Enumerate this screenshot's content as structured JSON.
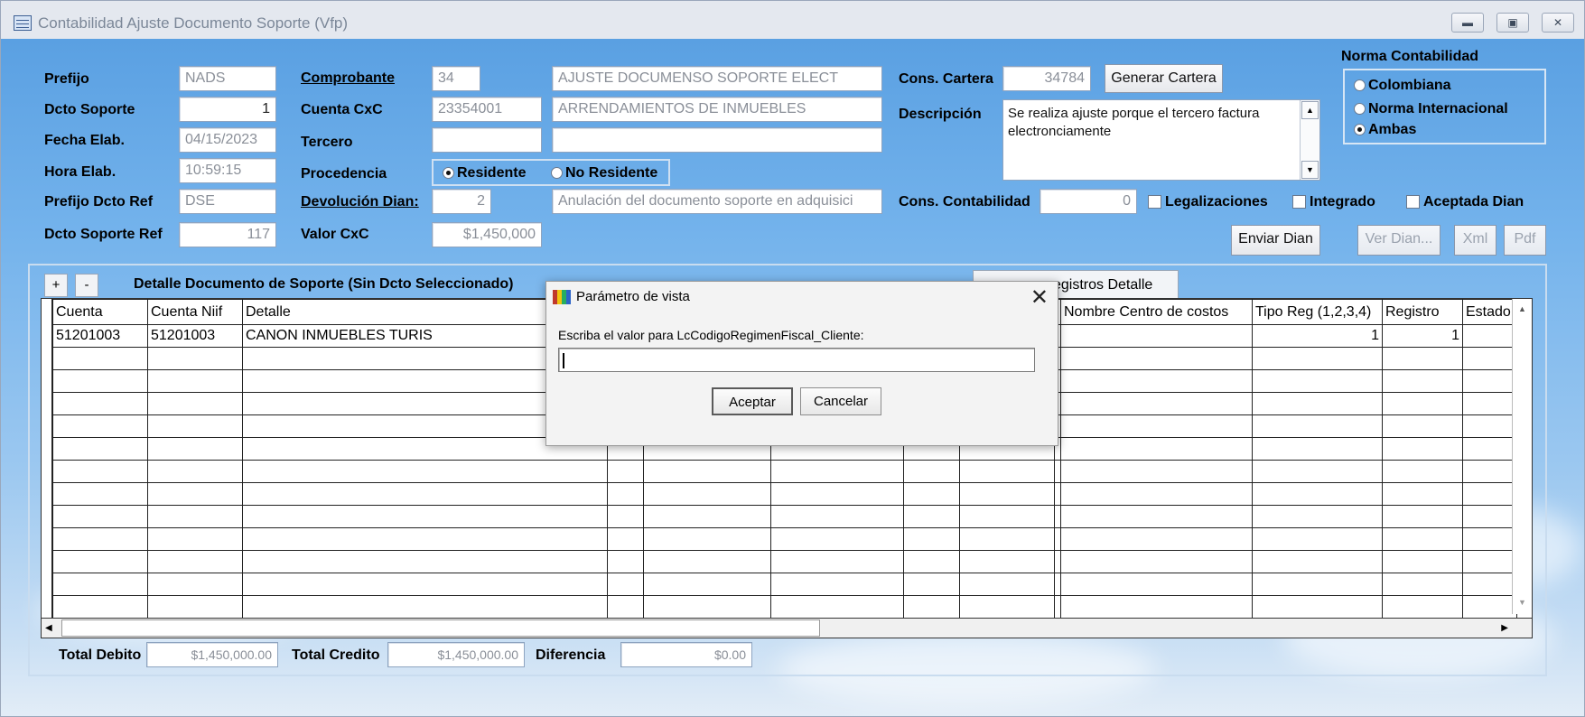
{
  "window": {
    "title": "Contabilidad Ajuste Documento Soporte (Vfp)",
    "controls": [
      "minimize",
      "maximize",
      "close"
    ]
  },
  "header": {
    "prefijo_label": "Prefijo",
    "prefijo_value": "NADS",
    "dcto_soporte_label": "Dcto Soporte",
    "dcto_soporte_value": "1",
    "fecha_label": "Fecha Elab.",
    "fecha_value": "04/15/2023",
    "hora_label": "Hora Elab.",
    "hora_value": "10:59:15",
    "prefijo_ref_label": "Prefijo Dcto Ref",
    "prefijo_ref_value": "DSE",
    "dcto_ref_label": "Dcto Soporte Ref",
    "dcto_ref_value": "117",
    "comprobante_label": "Comprobante",
    "comprobante_code": "34",
    "comprobante_desc": "AJUSTE DOCUMENSO SOPORTE ELECT",
    "cuenta_cxc_label": "Cuenta CxC",
    "cuenta_cxc_code": "23354001",
    "cuenta_cxc_desc": "ARRENDAMIENTOS DE INMUEBLES",
    "tercero_label": "Tercero",
    "tercero_code": "",
    "tercero_name": "",
    "procedencia_label": "Procedencia",
    "procedencia_options": {
      "residente": "Residente",
      "no_residente": "No Residente"
    },
    "procedencia_selected": "residente",
    "devolucion_label": "Devolución Dian:",
    "devolucion_code": "2",
    "devolucion_desc": "Anulación del documento soporte en adquisici",
    "valor_cxc_label": "Valor CxC",
    "valor_cxc_value": "$1,450,000",
    "cons_cartera_label": "Cons. Cartera",
    "cons_cartera_value": "34784",
    "generar_cartera_label": "Generar Cartera",
    "descripcion_label": "Descripción",
    "descripcion_value": "Se realiza ajuste porque el tercero factura electronciamente",
    "cons_contabilidad_label": "Cons. Contabilidad",
    "cons_contabilidad_value": "0",
    "legalizaciones_label": "Legalizaciones",
    "integrado_label": "Integrado",
    "aceptada_dian_label": "Aceptada Dian",
    "enviar_dian_label": "Enviar Dian",
    "ver_dian_label": "Ver Dian...",
    "xml_label": "Xml",
    "pdf_label": "Pdf"
  },
  "norma": {
    "title": "Norma Contabilidad",
    "options": [
      "Colombiana",
      "Norma Internacional",
      "Ambas"
    ],
    "selected": "Ambas"
  },
  "detail": {
    "add_label": "+",
    "remove_label": "-",
    "title": "Detalle Documento de Soporte (Sin Dcto Seleccionado)",
    "registros_tab_label": "egistros Detalle",
    "columns": [
      "Cuenta",
      "Cuenta Niif",
      "Detalle",
      "",
      "",
      "",
      "",
      "",
      "",
      "Nombre Centro de costos",
      "Tipo Reg (1,2,3,4)",
      "Registro",
      "Estado"
    ],
    "rows": [
      [
        "51201003",
        "51201003",
        "CANON INMUEBLES TURIS",
        "",
        "",
        "",
        "",
        "",
        "",
        "",
        "1",
        "1",
        ""
      ]
    ],
    "empty_rows": 12
  },
  "totals": {
    "debito_label": "Total Debito",
    "debito_value": "$1,450,000.00",
    "credito_label": "Total Credito",
    "credito_value": "$1,450,000.00",
    "diferencia_label": "Diferencia",
    "diferencia_value": "$0.00"
  },
  "dialog": {
    "title": "Parámetro de vista",
    "prompt": "Escriba el valor para LcCodigoRegimenFiscal_Cliente:",
    "input_value": "",
    "ok_label": "Aceptar",
    "cancel_label": "Cancelar"
  }
}
